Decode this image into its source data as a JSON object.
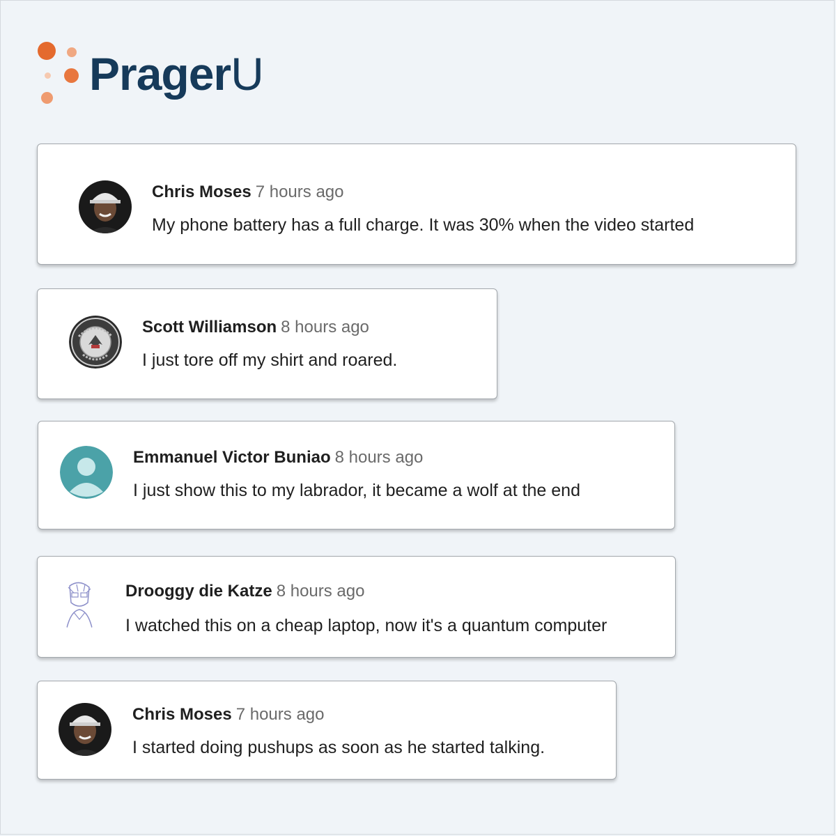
{
  "brand": {
    "name_bold": "Prager",
    "name_thin": "U",
    "color_text": "#163a5a",
    "color_dots": "#e46a2e"
  },
  "comments": [
    {
      "author": "Chris Moses",
      "time": "7 hours ago",
      "text": "My phone battery has a full charge. It was 30% when the video started",
      "avatar": "photo-man-cap-icon"
    },
    {
      "author": "Scott Williamson",
      "time": "8 hours ago",
      "text": "I just tore off my shirt and roared.",
      "avatar": "patriot-life-member-badge-icon"
    },
    {
      "author": "Emmanuel Victor Buniao",
      "time": "8 hours ago",
      "text": "I just show this to my labrador, it became a wolf at the end",
      "avatar": "default-user-icon"
    },
    {
      "author": "Drooggy die Katze",
      "time": "8 hours ago",
      "text": "I watched this on a cheap laptop, now it's a quantum computer",
      "avatar": "sketch-portrait-icon"
    },
    {
      "author": "Chris Moses",
      "time": "7 hours ago",
      "text": "I started doing pushups as soon as he started talking.",
      "avatar": "photo-man-cap-icon"
    }
  ]
}
